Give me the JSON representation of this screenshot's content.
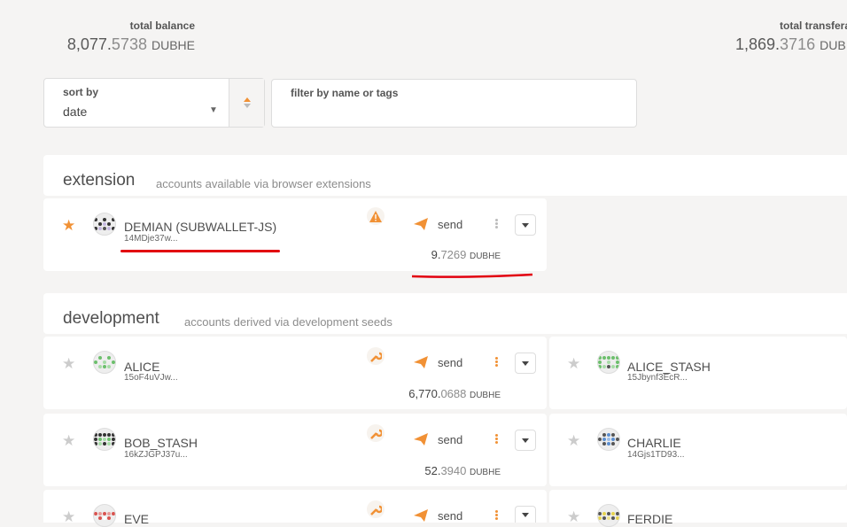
{
  "summary": {
    "total_balance": {
      "label": "total balance",
      "int": "8,077.",
      "dec": "5738",
      "unit": "DUBHE"
    },
    "total_transferable": {
      "label": "total transfera",
      "int": "1,869.",
      "dec": "3716",
      "unit": "DUB"
    }
  },
  "controls": {
    "sort": {
      "label": "sort by",
      "value": "date"
    },
    "filter": {
      "label": "filter by name or tags",
      "value": ""
    }
  },
  "sections": {
    "extension": {
      "title": "extension",
      "subtitle": "accounts available via browser extensions"
    },
    "development": {
      "title": "development",
      "subtitle": "accounts derived via development seeds"
    }
  },
  "accounts": {
    "demian": {
      "name": "DEMIAN (SUBWALLET-JS)",
      "address": "14MDje37w...",
      "send": "send",
      "balance_int": "9.",
      "balance_dec": "7269",
      "unit": "DUBHE",
      "favorite": true,
      "badge": "warning-icon"
    },
    "alice": {
      "name": "ALICE",
      "address": "15oF4uVJw...",
      "send": "send",
      "balance_int": "6,770.",
      "balance_dec": "0688",
      "unit": "DUBHE",
      "badge": "wrench-icon"
    },
    "alice_stash": {
      "name": "ALICE_STASH",
      "address": "15Jbynf3EcR..."
    },
    "bob_stash": {
      "name": "BOB_STASH",
      "address": "16kZJGPJ37u...",
      "send": "send",
      "balance_int": "52.",
      "balance_dec": "3940",
      "unit": "DUBHE",
      "badge": "wrench-icon"
    },
    "charlie": {
      "name": "CHARLIE",
      "address": "14Gjs1TD93..."
    },
    "eve": {
      "name": "EVE",
      "send": "send",
      "badge": "wrench-icon"
    },
    "ferdie": {
      "name": "FERDIE"
    }
  },
  "colors": {
    "accent": "#f19135",
    "annotation": "#e2000f"
  }
}
